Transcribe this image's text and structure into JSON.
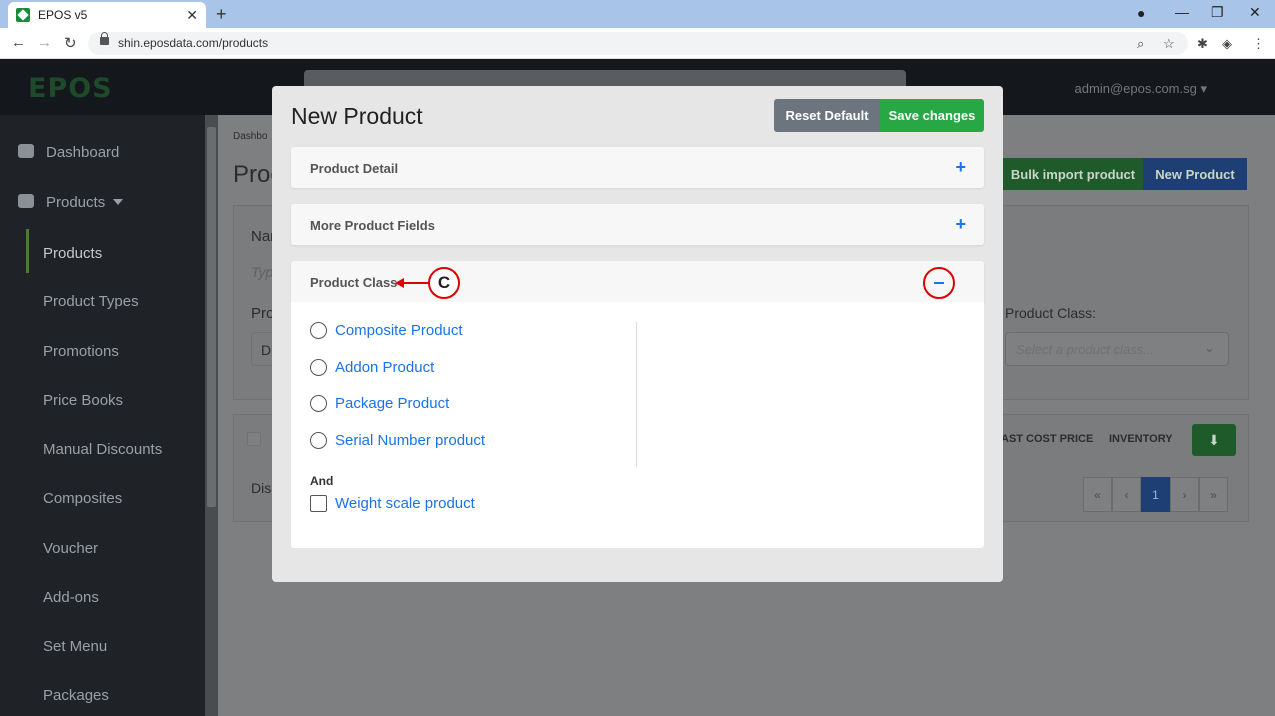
{
  "browser": {
    "tab_title": "EPOS v5",
    "tab_close": "✕",
    "new_tab": "+",
    "url": "shin.eposdata.com/products",
    "win_min": "—",
    "win_max": "❐",
    "win_close": "✕"
  },
  "app": {
    "logo": "EPOS",
    "user": "admin@epos.com.sg ▾"
  },
  "sidebar": {
    "items": [
      {
        "label": "Dashboard"
      },
      {
        "label": "Products"
      },
      {
        "label": "Products"
      },
      {
        "label": "Product Types"
      },
      {
        "label": "Promotions"
      },
      {
        "label": "Price Books"
      },
      {
        "label": "Manual Discounts"
      },
      {
        "label": "Composites"
      },
      {
        "label": "Voucher"
      },
      {
        "label": "Add-ons"
      },
      {
        "label": "Set Menu"
      },
      {
        "label": "Packages"
      }
    ]
  },
  "background": {
    "breadcrumb": "Dashbo",
    "page_title": "Proc",
    "name_label": "Nar",
    "type_hint": "Typ",
    "pro_label": "Pro",
    "select_d": "D",
    "dis_label": "Dis",
    "bulk_import": "Bulk import product",
    "new_product": "New Product",
    "product_class_label": "Product Class:",
    "product_class_placeholder": "Select a product class...",
    "col_last_cost": "AST COST PRICE",
    "col_inventory": "INVENTORY",
    "pager": [
      "«",
      "‹",
      "1",
      "›",
      "»"
    ]
  },
  "modal": {
    "title": "New Product",
    "reset_label": "Reset Default",
    "save_label": "Save changes",
    "sections": [
      {
        "title": "Product Detail",
        "toggle": "+"
      },
      {
        "title": "More Product Fields",
        "toggle": "+"
      },
      {
        "title": "Product Class"
      }
    ],
    "callout": "C",
    "class_options": [
      "Composite Product",
      "Addon Product",
      "Package Product",
      "Serial Number product"
    ],
    "and_label": "And",
    "checkbox_option": "Weight scale product"
  }
}
